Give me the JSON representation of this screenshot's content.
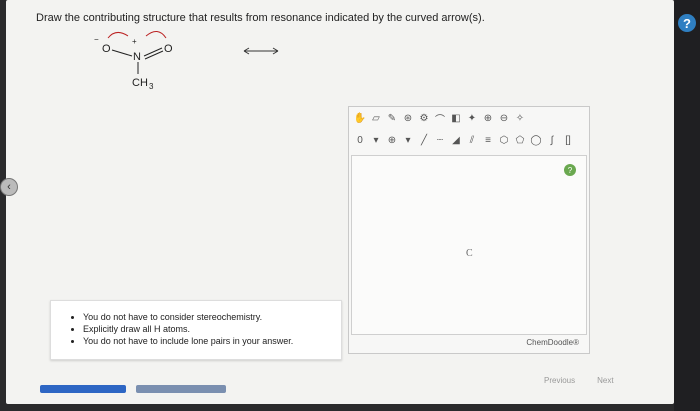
{
  "question": "Draw the contributing structure that results from resonance indicated by the curved arrow(s).",
  "molecule": {
    "atom_o_left": "O",
    "atom_n_center": "N",
    "atom_o_right": "O",
    "charge_left": "−",
    "charge_n": "+",
    "methyl_label": "CH",
    "methyl_subscript": "3"
  },
  "editor": {
    "toolbar_row1": [
      "hand-icon",
      "eraser-icon",
      "pencil-icon",
      "ring-icon",
      "cycle-icon",
      "lasso-icon",
      "template-icon",
      "clean-icon",
      "zoom-in-icon",
      "zoom-out-icon",
      "wand-icon"
    ],
    "charge_value": "0",
    "canvas_center_label": "C",
    "brand": "ChemDoodle",
    "brand_mark": "®"
  },
  "instructions": [
    "You do not have to consider stereochemistry.",
    "Explicitly draw all H atoms.",
    "You do not have to include lone pairs in your answer."
  ],
  "pager": {
    "previous": "Previous",
    "next": "Next"
  },
  "help_label": "?"
}
